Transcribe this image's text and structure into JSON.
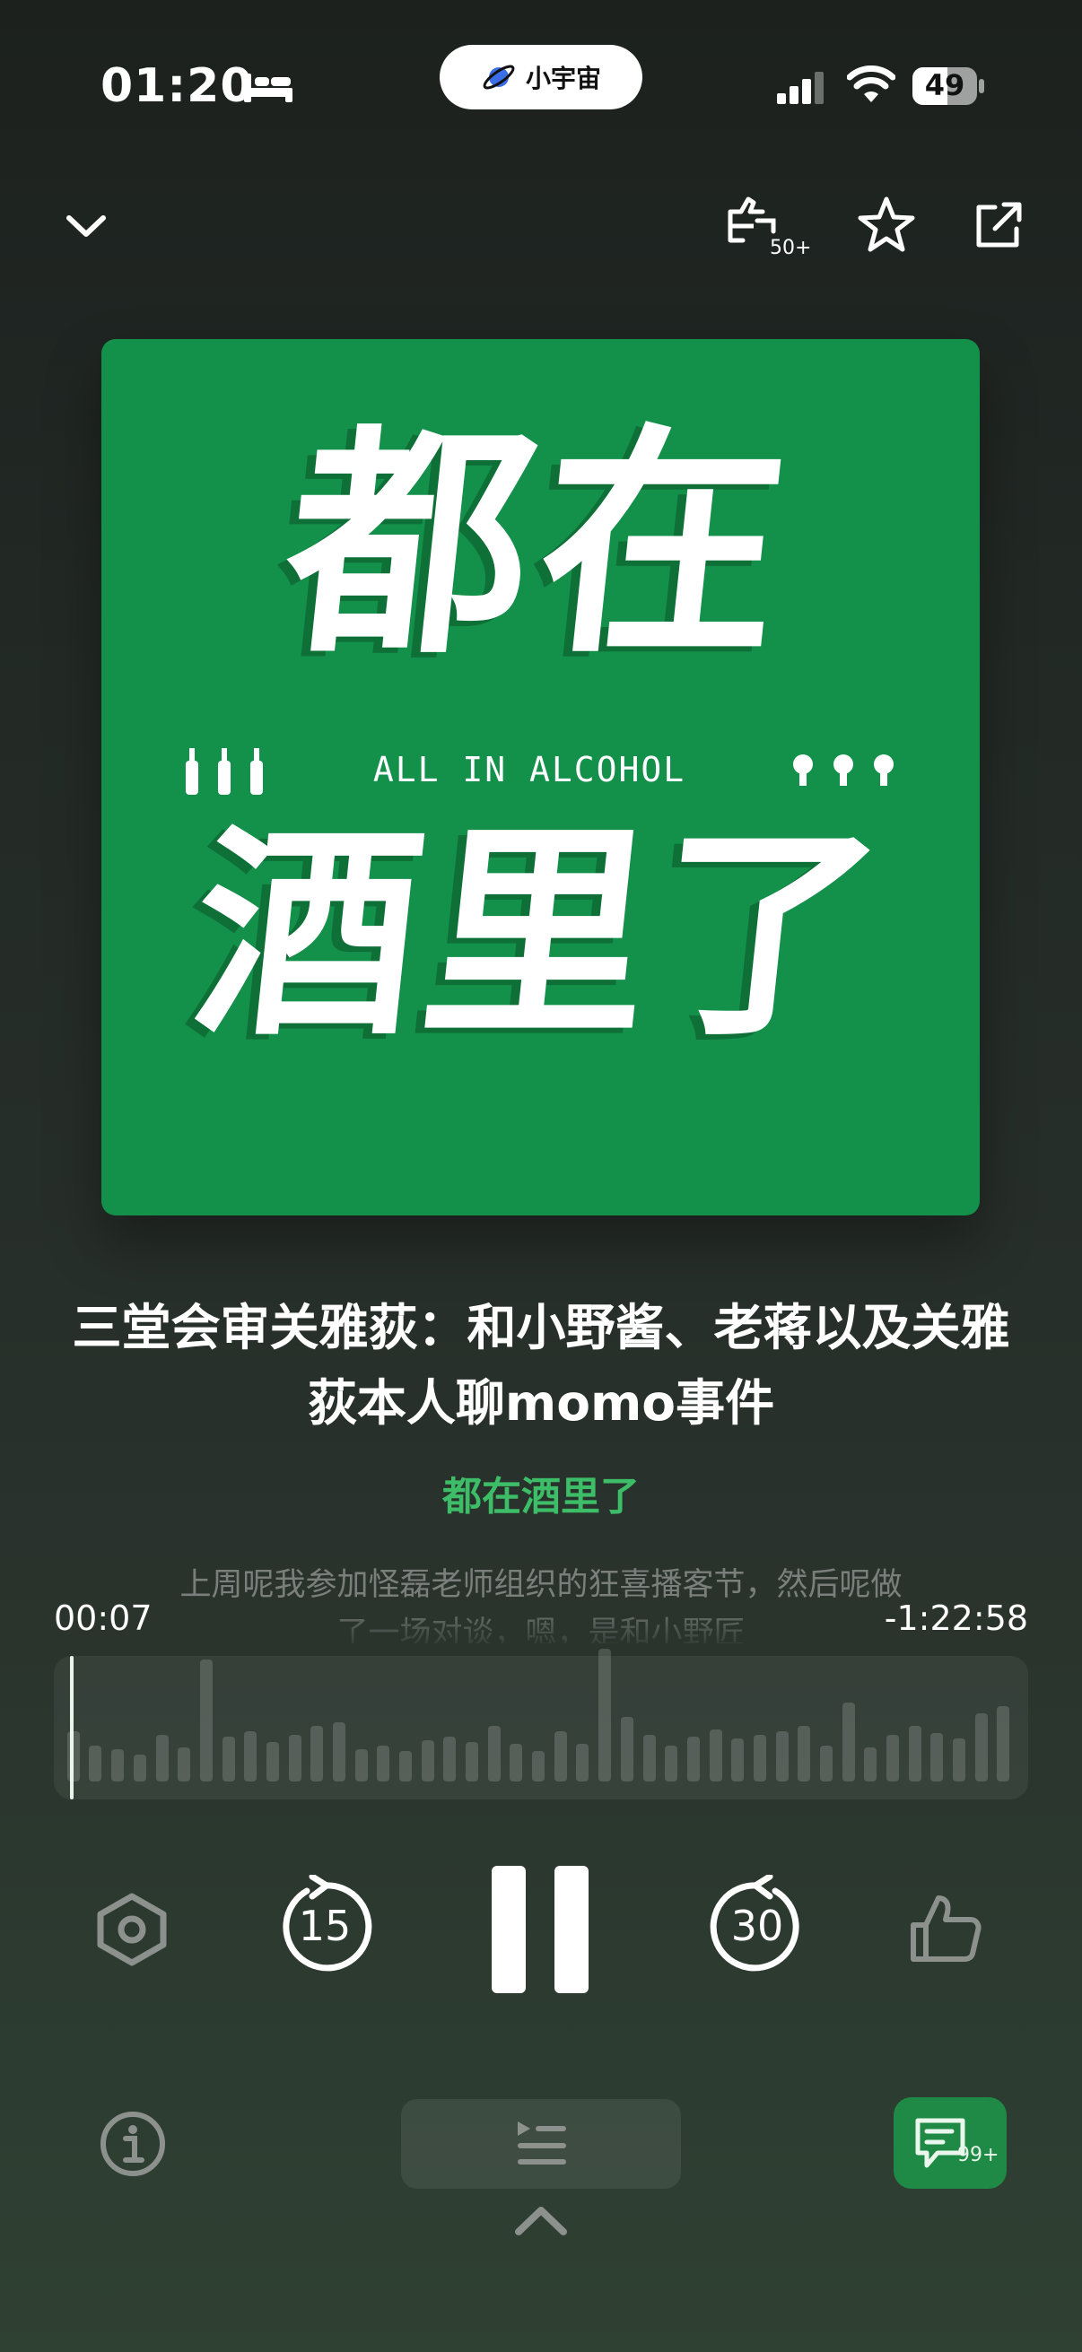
{
  "status_bar": {
    "time": "01:20",
    "app_pill": "小宇宙",
    "battery": "49"
  },
  "top_actions": {
    "likes_count": "50+"
  },
  "cover": {
    "line1": "都在",
    "tagline": "ALL IN ALCOHOL",
    "line2": "酒里了",
    "bg_color": "#13904a"
  },
  "episode": {
    "title": "三堂会审关雅荻：和小野酱、老蒋以及关雅荻本人聊momo事件",
    "show": "都在酒里了",
    "transcript": "上周呢我参加怪磊老师组织的狂喜播客节，然后呢做了一场对谈，嗯，是和小野匠"
  },
  "progress": {
    "elapsed": "00:07",
    "remaining": "-1:22:58",
    "fraction": 0.0014
  },
  "controls": {
    "skip_back": "15",
    "skip_forward": "30"
  },
  "bottom_bar": {
    "comments_count": "99+"
  },
  "colors": {
    "accent": "#3dbd67",
    "comment_bg": "#1f8a45"
  }
}
